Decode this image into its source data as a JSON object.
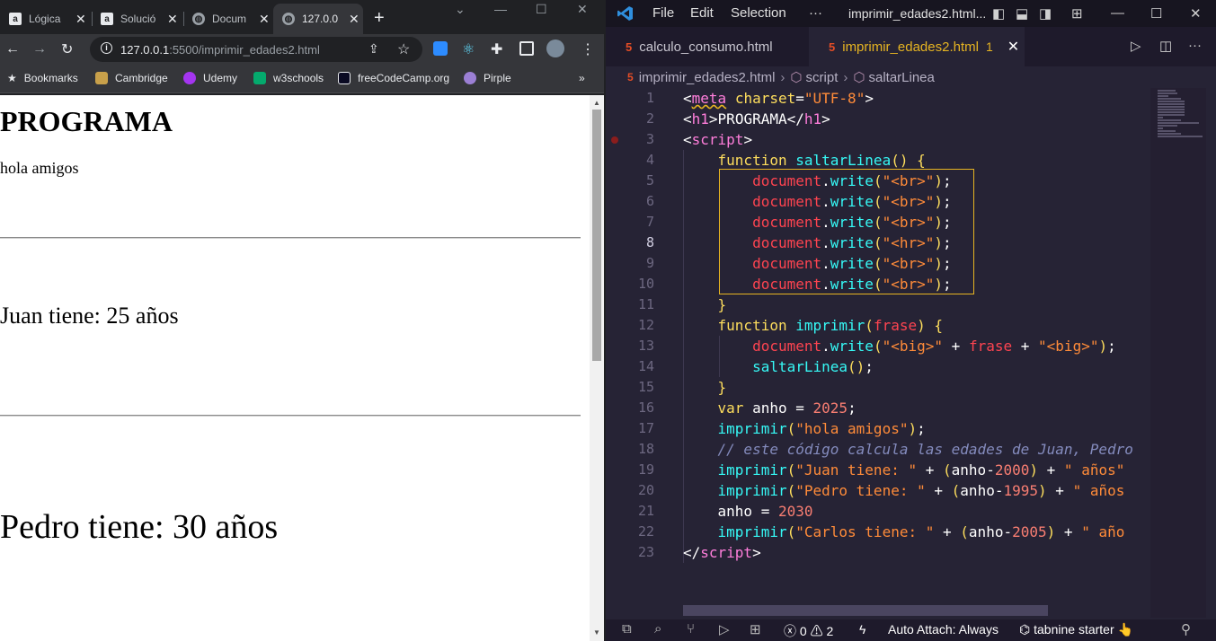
{
  "browser": {
    "tabs": [
      {
        "title": "Lógica",
        "favicon": "a"
      },
      {
        "title": "Solució",
        "favicon": "a"
      },
      {
        "title": "Docum",
        "favicon": "globe"
      },
      {
        "title": "127.0.0",
        "favicon": "globe"
      }
    ],
    "address": {
      "host": "127.0.0.1",
      "path": ":5500/imprimir_edades2.html"
    },
    "bookmarks": [
      "Bookmarks",
      "Cambridge",
      "Udemy",
      "w3schools",
      "freeCodeCamp.org",
      "Pirple"
    ],
    "page": {
      "heading": "PROGRAMA",
      "line1": "hola amigos",
      "big1": "Juan tiene: 25 años",
      "big2": "Pedro tiene: 30 años"
    }
  },
  "vscode": {
    "menu": [
      "File",
      "Edit",
      "Selection",
      "···"
    ],
    "window_title": "imprimir_edades2.html...",
    "tabs": [
      {
        "label": "calculo_consumo.html",
        "active": false
      },
      {
        "label": "imprimir_edades2.html",
        "active": true,
        "badge": "1"
      }
    ],
    "breadcrumb": [
      "imprimir_edades2.html",
      "script",
      "saltarLinea"
    ],
    "line_numbers": [
      "1",
      "2",
      "3",
      "4",
      "5",
      "6",
      "7",
      "8",
      "9",
      "10",
      "11",
      "12",
      "13",
      "14",
      "15",
      "16",
      "17",
      "18",
      "19",
      "20",
      "21",
      "22",
      "23"
    ],
    "current_line": "8",
    "status": {
      "errors": "0",
      "warnings": "2",
      "auto_attach": "Auto Attach: Always",
      "tabnine": "tabnine starter"
    }
  }
}
